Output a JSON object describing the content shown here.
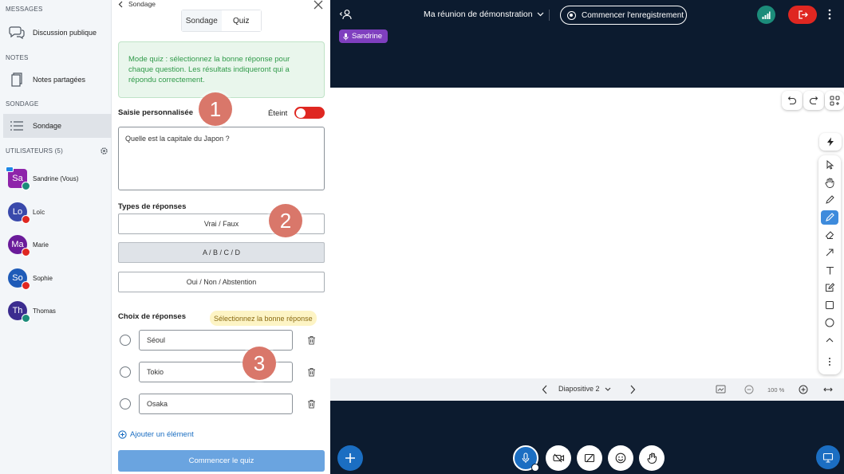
{
  "sidebar": {
    "messages_title": "MESSAGES",
    "public_chat": "Discussion publique",
    "notes_title": "NOTES",
    "shared_notes": "Notes partagées",
    "poll_title": "SONDAGE",
    "poll_item": "Sondage",
    "users_title": "UTILISATEURS (5)",
    "users": [
      {
        "initials": "Sa",
        "name": "Sandrine (Vous)",
        "color": "#8e24aa"
      },
      {
        "initials": "Lo",
        "name": "Loïc",
        "color": "#3949ab"
      },
      {
        "initials": "Ma",
        "name": "Marie",
        "color": "#6a1b9a"
      },
      {
        "initials": "So",
        "name": "Sophie",
        "color": "#1e5bb8"
      },
      {
        "initials": "Th",
        "name": "Thomas",
        "color": "#3b2c8f"
      }
    ]
  },
  "panel": {
    "back_label": "Sondage",
    "tab_poll": "Sondage",
    "tab_quiz": "Quiz",
    "info": "Mode quiz : sélectionnez la bonne réponse pour chaque question. Les résultats indiqueront qui a répondu correctement.",
    "custom_input_label": "Saisie personnalisée",
    "toggle_state": "Éteint",
    "question": "Quelle est la capitale du Japon ?",
    "response_types_label": "Types de réponses",
    "response_types": [
      "Vrai / Faux",
      "A / B / C / D",
      "Oui / Non / Abstention"
    ],
    "choices_label": "Choix de réponses",
    "choices_hint": "Sélectionnez la bonne réponse",
    "answers": [
      "Séoul",
      "Tokio",
      "Osaka"
    ],
    "add_item": "Ajouter un élément",
    "start_quiz": "Commencer le quiz",
    "steps": [
      "1",
      "2",
      "3"
    ]
  },
  "meeting": {
    "title": "Ma réunion de démonstration",
    "record": "Commencer l'enregistrement",
    "talking": "Sandrine",
    "slide": "Diapositive 2",
    "zoom": "100 %"
  },
  "colors": {
    "dark_bg": "#0c1b2f",
    "accent_blue": "#1b6ec2",
    "danger": "#df2721",
    "success": "#2f9a49"
  }
}
